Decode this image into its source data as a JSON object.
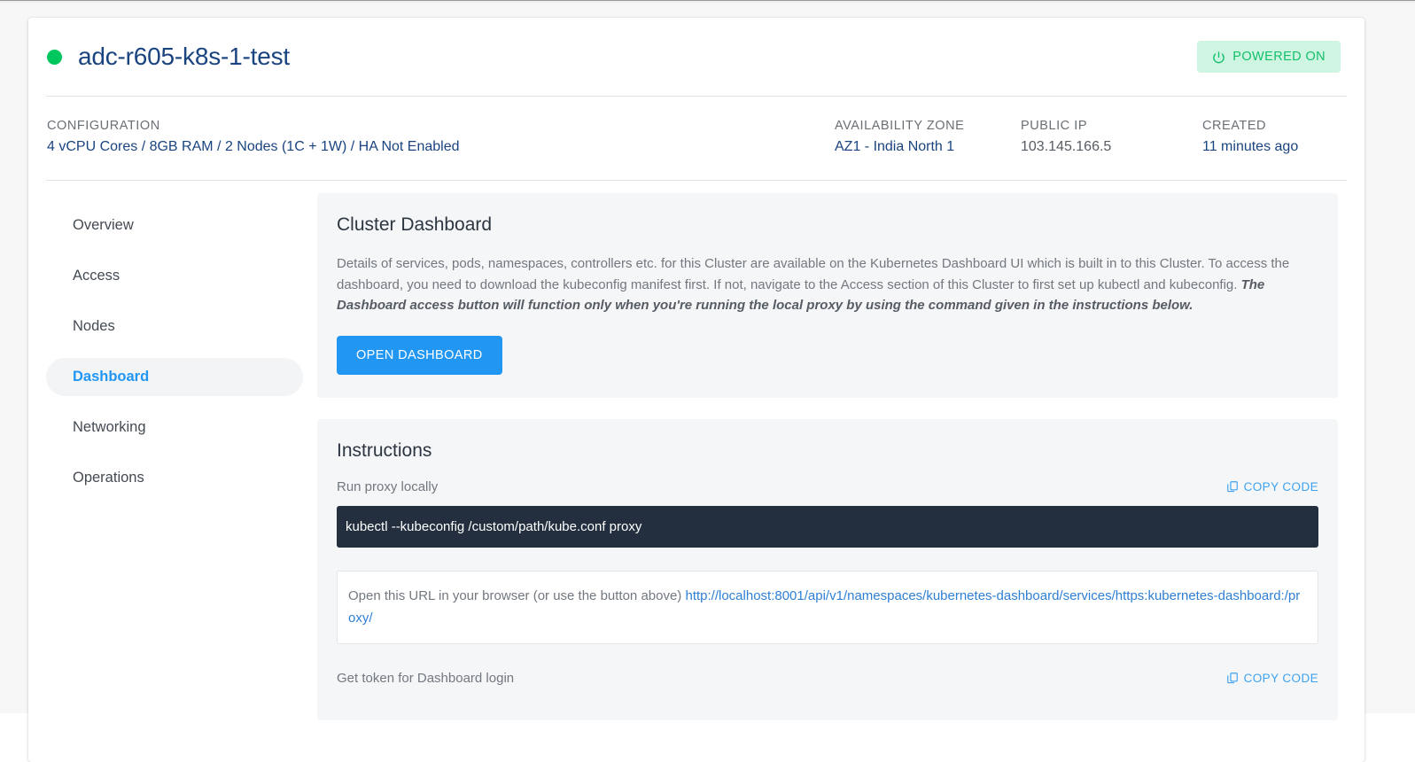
{
  "header": {
    "status_icon": "status-dot-green",
    "status_color": "#00c65e",
    "cluster_name": "adc-r605-k8s-1-test",
    "power_badge": {
      "icon": "power-icon",
      "label": "POWERED ON",
      "bg_color": "#cdf5e1",
      "text_color": "#13c06c"
    }
  },
  "meta": {
    "configuration": {
      "label": "CONFIGURATION",
      "value": "4 vCPU Cores / 8GB RAM / 2 Nodes (1C + 1W) / HA Not Enabled"
    },
    "availability_zone": {
      "label": "AVAILABILITY ZONE",
      "value": "AZ1 - India North 1"
    },
    "public_ip": {
      "label": "PUBLIC IP",
      "value": "103.145.166.5"
    },
    "created": {
      "label": "CREATED",
      "value": "11 minutes ago"
    }
  },
  "sidebar": {
    "items": [
      {
        "label": "Overview",
        "active": false
      },
      {
        "label": "Access",
        "active": false
      },
      {
        "label": "Nodes",
        "active": false
      },
      {
        "label": "Dashboard",
        "active": true
      },
      {
        "label": "Networking",
        "active": false
      },
      {
        "label": "Operations",
        "active": false
      }
    ],
    "active_color": "#2196f3"
  },
  "dashboard_panel": {
    "title": "Cluster Dashboard",
    "description": "Details of services, pods, namespaces, controllers etc. for this Cluster are available on the Kubernetes Dashboard UI which is built in to this Cluster. To access the dashboard, you need to download the kubeconfig manifest first. If not, navigate to the Access section of this Cluster to first set up kubectl and kubeconfig.",
    "emphasis": "The Dashboard access button will function only when you're running the local proxy by using the command given in the instructions below.",
    "open_button": "OPEN DASHBOARD",
    "open_button_color": "#2196f3"
  },
  "instructions_panel": {
    "title": "Instructions",
    "steps": [
      {
        "label": "Run proxy locally",
        "copy_label": "COPY CODE",
        "code": "kubectl --kubeconfig /custom/path/kube.conf proxy"
      },
      {
        "label": "Get token for Dashboard login",
        "copy_label": "COPY CODE"
      }
    ],
    "url_note": {
      "prefix": "Open this URL in your browser (or use the button above) ",
      "url": "http://localhost:8001/api/v1/namespaces/kubernetes-dashboard/services/https:kubernetes-dashboard:/proxy/"
    }
  }
}
